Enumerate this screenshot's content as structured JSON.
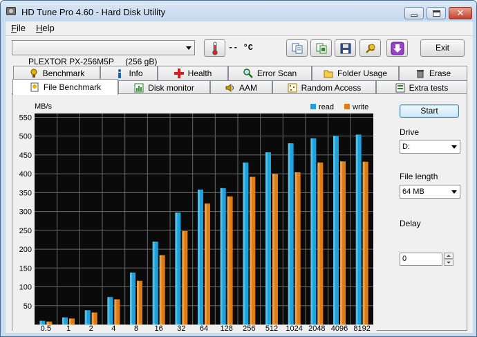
{
  "window": {
    "title": "HD Tune Pro 4.60 - Hard Disk Utility"
  },
  "menu": {
    "file_u": "F",
    "file_rest": "ile",
    "help_u": "H",
    "help_rest": "elp"
  },
  "toolbar": {
    "drive_selected": "PLEXTOR PX-256M5P     (256 gB)",
    "temperature": "-- °C",
    "exit_label": "Exit"
  },
  "tabs_top": [
    {
      "label": "Benchmark",
      "icon": "benchmark-icon"
    },
    {
      "label": "Info",
      "icon": "info-icon"
    },
    {
      "label": "Health",
      "icon": "health-icon"
    },
    {
      "label": "Error Scan",
      "icon": "magnifier-icon"
    },
    {
      "label": "Folder Usage",
      "icon": "folder-icon"
    },
    {
      "label": "Erase",
      "icon": "trash-icon"
    }
  ],
  "tabs_bottom": [
    {
      "label": "File Benchmark",
      "icon": "file-benchmark-icon",
      "active": true
    },
    {
      "label": "Disk monitor",
      "icon": "disk-monitor-icon"
    },
    {
      "label": "AAM",
      "icon": "speaker-icon"
    },
    {
      "label": "Random Access",
      "icon": "random-access-icon"
    },
    {
      "label": "Extra tests",
      "icon": "extra-tests-icon"
    }
  ],
  "side_panel": {
    "start_label": "Start",
    "drive_label": "Drive",
    "drive_value": "D:",
    "file_length_label": "File length",
    "file_length_value": "64 MB",
    "delay_label": "Delay",
    "delay_value": "0"
  },
  "chart_data": {
    "type": "bar",
    "ylabel": "MB/s",
    "ylim": [
      0,
      560
    ],
    "y_ticks": [
      50,
      100,
      150,
      200,
      250,
      300,
      350,
      400,
      450,
      500,
      550
    ],
    "categories": [
      "0.5",
      "1",
      "2",
      "4",
      "8",
      "16",
      "32",
      "64",
      "128",
      "256",
      "512",
      "1024",
      "2048",
      "4096",
      "8192"
    ],
    "legend_position": "top-right",
    "grid": true,
    "series": [
      {
        "name": "read",
        "color": "#1aa3dc",
        "values": [
          10,
          19,
          38,
          73,
          138,
          220,
          297,
          358,
          362,
          430,
          457,
          481,
          494,
          501,
          504
        ]
      },
      {
        "name": "write",
        "color": "#e07c10",
        "values": [
          8,
          16,
          32,
          67,
          116,
          184,
          248,
          321,
          340,
          392,
          400,
          404,
          430,
          433,
          432
        ]
      }
    ]
  }
}
